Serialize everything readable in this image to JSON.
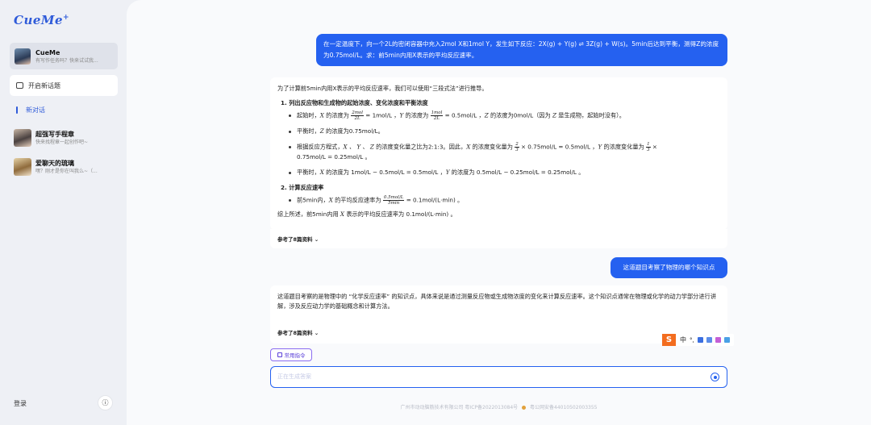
{
  "sidebar": {
    "logo": "CueMe",
    "logo_plus": "+",
    "agent": {
      "title": "CueMe",
      "subtitle": "有写作任务吗？快来试试我..."
    },
    "new_topic": "开启新话题",
    "new_chat": "新对话",
    "history": [
      {
        "title": "超强写手程章",
        "subtitle": "快来找程章一起创作吧~"
      },
      {
        "title": "爱聊天的琉璃",
        "subtitle": "嘿？刚才是你在叫我么~（..."
      }
    ],
    "login": "登录",
    "info_icon": "ⓘ"
  },
  "chat": {
    "q1": "在一定温度下，向一个2L的密闭容器中充入2mol X和1mol Y，发生如下反应：2X(g) + Y(g) ⇌ 3Z(g) + W(s)。5min后达到平衡，测得Z的浓度为0.75mol/L。求：前5min内用X表示的平均反应速率。",
    "a1": {
      "intro": "为了计算前5min内用X表示的平均反应速率，我们可以使用“三段式法”进行推导。",
      "h1": "1. 列出反应物和生成物的起始浓度、变化浓度和平衡浓度",
      "b1_a": "起始时，",
      "b1_x": "X",
      "b1_b": " 的浓度为 ",
      "b1_f1_num": "2mol",
      "b1_f1_den": "2L",
      "b1_c": " = 1mol/L ，",
      "b1_y": "Y",
      "b1_d": " 的浓度为 ",
      "b1_f2_num": "1mol",
      "b1_f2_den": "2L",
      "b1_e": " = 0.5mol/L ，",
      "b1_z": "Z",
      "b1_f": " 的浓度为0mol/L（因为 ",
      "b1_z2": "Z",
      "b1_g": " 是生成物，起始时没有）。",
      "b2_a": "平衡时，",
      "b2_z": "Z",
      "b2_b": " 的浓度为0.75mol/L。",
      "b3_a": "根据反应方程式，",
      "b3_vars": "X 、 Y 、 Z",
      "b3_b": " 的浓度变化量之比为2:1:3。因此，",
      "b3_x": "X",
      "b3_c": " 的浓度变化量为 ",
      "b3_f1_num": "2",
      "b3_f1_den": "3",
      "b3_d": " × 0.75mol/L = 0.5mol/L ，",
      "b3_y": "Y",
      "b3_e": " 的浓度变化量为 ",
      "b3_f2_num": "1",
      "b3_f2_den": "3",
      "b3_f": " ×",
      "b3_g": "0.75mol/L = 0.25mol/L 。",
      "b4_a": "平衡时，",
      "b4_x": "X",
      "b4_b": " 的浓度为 1mol/L − 0.5mol/L = 0.5mol/L ，",
      "b4_y": "Y",
      "b4_c": " 的浓度为 0.5mol/L − 0.25mol/L = 0.25mol/L 。",
      "h2": "2. 计算反应速率",
      "b5_a": "前5min内，",
      "b5_x": "X",
      "b5_b": " 的平均反应速率为 ",
      "b5_f_num": "0.5mol/L",
      "b5_f_den": "5min",
      "b5_c": " = 0.1mol/(L·min) 。",
      "sum_a": "综上所述，前5min内用 ",
      "sum_x": "X",
      "sum_b": " 表示的平均反应速率为 0.1mol/(L·min) 。",
      "ref": "参考了8篇资料"
    },
    "q2": "这道题目考察了物理的哪个知识点",
    "a2": {
      "text": "这道题目考察的是物理中的 “化学反应速率” 的知识点，具体来说是通过测量反应物或生成物浓度的变化来计算反应速率。这个知识点通常在物理或化学的动力学部分进行讲解，涉及反应动力学的基础概念和计算方法。",
      "ref": "参考了8篇资料"
    }
  },
  "composer": {
    "cmd_label": "常用指令",
    "placeholder": "正在生成答案"
  },
  "footer": {
    "company": "广州市动动脑筋技术有限公司 粤ICP备2022013084号",
    "police": "粤公网安备44010502003355"
  },
  "ime": {
    "logo": "S",
    "zh": "中",
    "punct": "°,"
  },
  "colors": {
    "accent": "#2561f0",
    "cmd": "#8a6cf0"
  }
}
